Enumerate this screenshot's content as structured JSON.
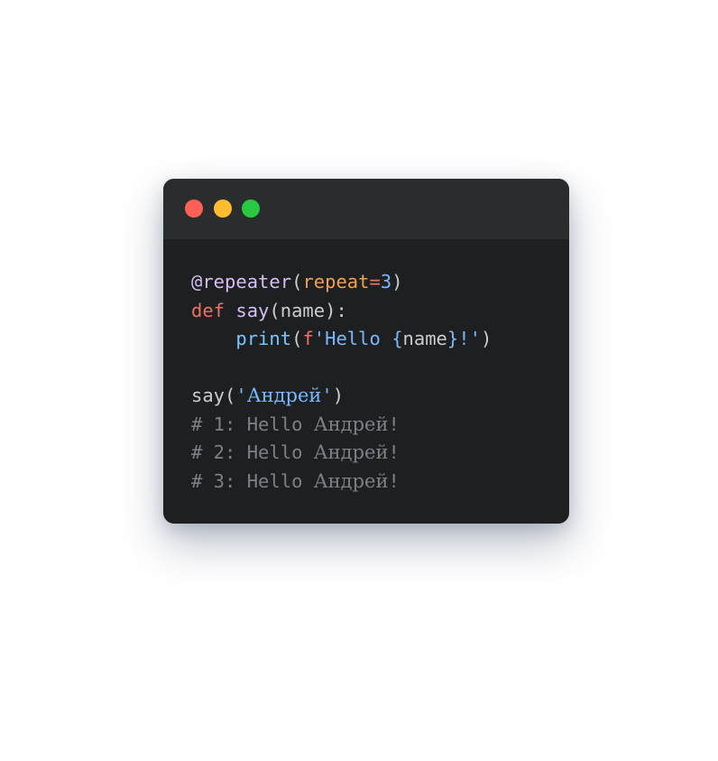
{
  "window": {
    "traffic_lights": {
      "close_color": "#fe5f57",
      "minimize_color": "#febc2e",
      "zoom_color": "#28c840"
    }
  },
  "palette": {
    "text": "#c9cdd1",
    "decorator": "#d6bdf2",
    "keyword": "#f07066",
    "param": "#f3a04f",
    "number": "#79b8ff",
    "function": "#76c6ff",
    "string": "#79b8ff",
    "comment": "#7b8187"
  },
  "code": {
    "lines": [
      {
        "tokens": [
          {
            "text": "@repeater",
            "kind": "decorator"
          },
          {
            "text": "(",
            "kind": "text"
          },
          {
            "text": "repeat",
            "kind": "param"
          },
          {
            "text": "=",
            "kind": "keyword"
          },
          {
            "text": "3",
            "kind": "number"
          },
          {
            "text": ")",
            "kind": "text"
          }
        ]
      },
      {
        "tokens": [
          {
            "text": "def",
            "kind": "keyword"
          },
          {
            "text": " ",
            "kind": "text"
          },
          {
            "text": "say",
            "kind": "decorator"
          },
          {
            "text": "(name):",
            "kind": "text"
          }
        ]
      },
      {
        "tokens": [
          {
            "text": "    ",
            "kind": "text"
          },
          {
            "text": "print",
            "kind": "function"
          },
          {
            "text": "(",
            "kind": "text"
          },
          {
            "text": "f",
            "kind": "keyword"
          },
          {
            "text": "'Hello ",
            "kind": "string"
          },
          {
            "text": "{",
            "kind": "string"
          },
          {
            "text": "name",
            "kind": "text"
          },
          {
            "text": "}!'",
            "kind": "string"
          },
          {
            "text": ")",
            "kind": "text"
          }
        ]
      },
      {
        "tokens": []
      },
      {
        "tokens": [
          {
            "text": "say(",
            "kind": "text"
          },
          {
            "text": "'",
            "kind": "string"
          },
          {
            "text": "Андрей",
            "kind": "string",
            "cyr": true
          },
          {
            "text": "'",
            "kind": "string"
          },
          {
            "text": ")",
            "kind": "text"
          }
        ]
      },
      {
        "tokens": [
          {
            "text": "# 1: Hello ",
            "kind": "comment"
          },
          {
            "text": "Андрей",
            "kind": "comment",
            "cyr": true
          },
          {
            "text": "!",
            "kind": "comment"
          }
        ]
      },
      {
        "tokens": [
          {
            "text": "# 2: Hello ",
            "kind": "comment"
          },
          {
            "text": "Андрей",
            "kind": "comment",
            "cyr": true
          },
          {
            "text": "!",
            "kind": "comment"
          }
        ]
      },
      {
        "tokens": [
          {
            "text": "# 3: Hello ",
            "kind": "comment"
          },
          {
            "text": "Андрей",
            "kind": "comment",
            "cyr": true
          },
          {
            "text": "!",
            "kind": "comment"
          }
        ]
      }
    ]
  }
}
